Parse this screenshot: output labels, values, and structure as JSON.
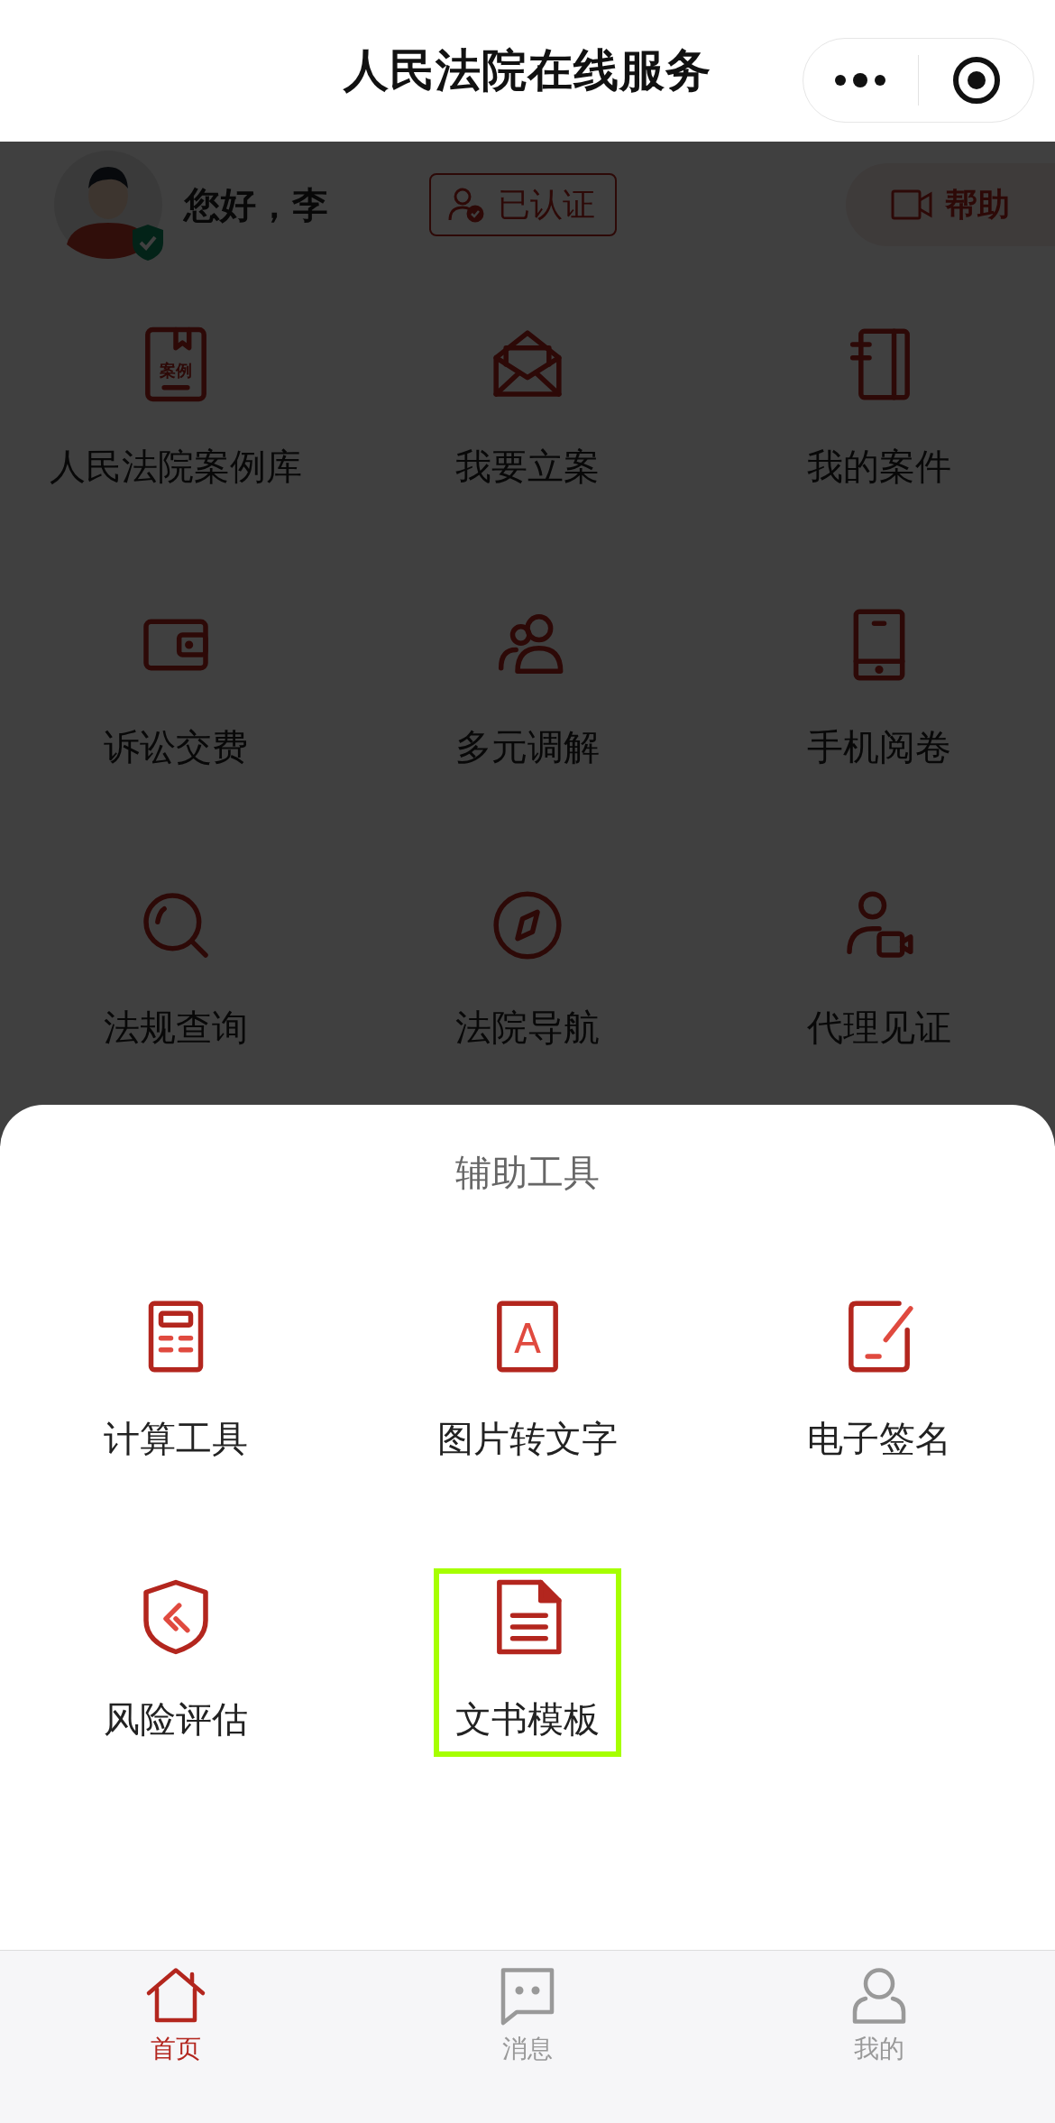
{
  "nav": {
    "title": "人民法院在线服务"
  },
  "profile": {
    "greeting": "您好，李",
    "verified_badge": "已认证",
    "help_button": "帮助"
  },
  "services": [
    {
      "label": "人民法院案例库",
      "icon_label": "案例"
    },
    {
      "label": "我要立案"
    },
    {
      "label": "我的案件"
    },
    {
      "label": "诉讼交费"
    },
    {
      "label": "多元调解"
    },
    {
      "label": "手机阅卷"
    },
    {
      "label": "法规查询"
    },
    {
      "label": "法院导航"
    },
    {
      "label": "代理见证"
    }
  ],
  "tool_sheet": {
    "title": "辅助工具",
    "items": [
      {
        "label": "计算工具",
        "selected": false
      },
      {
        "label": "图片转文字",
        "icon_label": "A",
        "selected": false
      },
      {
        "label": "电子签名",
        "selected": false
      },
      {
        "label": "风险评估",
        "selected": false
      },
      {
        "label": "文书模板",
        "selected": true
      }
    ]
  },
  "tab_bar": [
    {
      "label": "首页",
      "selected": true
    },
    {
      "label": "消息",
      "selected": false
    },
    {
      "label": "我的",
      "selected": false
    }
  ]
}
